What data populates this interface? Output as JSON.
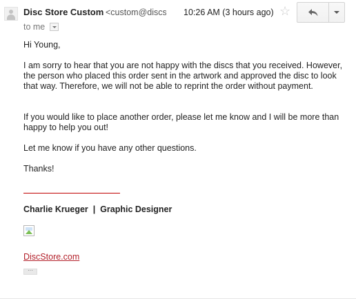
{
  "header": {
    "sender_name": "Disc Store Custom",
    "sender_email": "<custom@discstore.com>",
    "timestamp": "10:26 AM (3 hours ago)",
    "recipient": "to me",
    "icons": {
      "avatar": "default-avatar-icon",
      "star": "star-icon",
      "reply": "reply-icon",
      "more": "chevron-down-icon"
    }
  },
  "message": {
    "greeting": "Hi Young,",
    "paragraph_1": "I am sorry to hear that you are not happy with the discs that you received. However, the person who placed this order sent in the artwork and approved the disc to look that way. Therefore, we will not be able to reprint the order without payment.",
    "paragraph_2": "If you would like to place another order, please let me know and I will be more than happy to help you out!",
    "paragraph_3": "Let me know if you have any other questions.",
    "closing": "Thanks!"
  },
  "signature": {
    "name_title": "Charlie Krueger  |  Graphic Designer",
    "link_text": "DiscStore.com",
    "link_color": "#b3202a",
    "rule_color": "#c00000",
    "expand_label": "···"
  }
}
